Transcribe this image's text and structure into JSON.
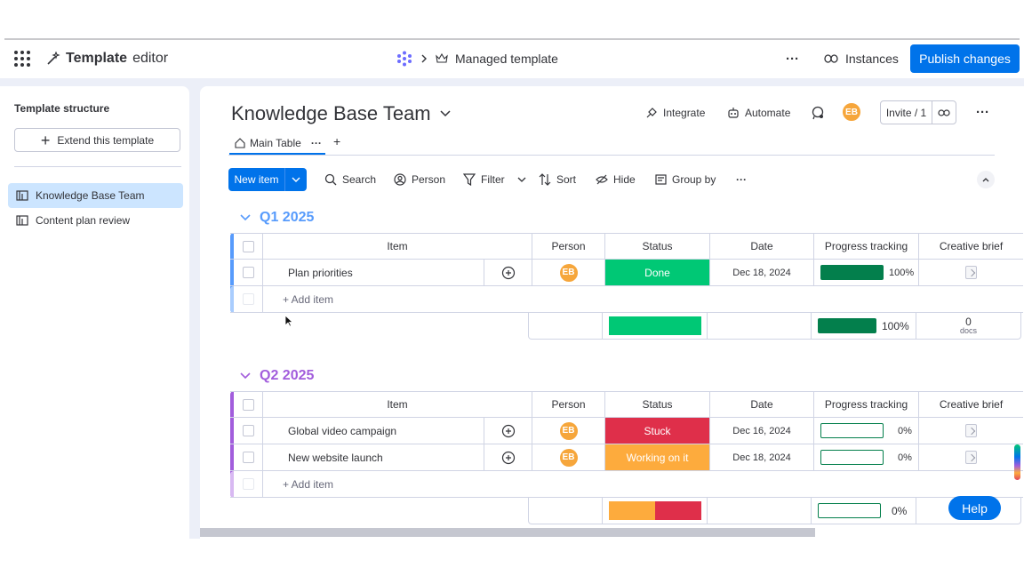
{
  "topbar": {
    "brand_bold": "Template",
    "brand_rest": "editor",
    "breadcrumb_current": "Managed template",
    "more_label": "···",
    "instances_label": "Instances",
    "publish_label": "Publish changes"
  },
  "sidebar": {
    "title": "Template structure",
    "extend_label": "Extend this template",
    "items": [
      {
        "label": "Knowledge Base Team",
        "active": true
      },
      {
        "label": "Content plan review",
        "active": false
      }
    ]
  },
  "board": {
    "title": "Knowledge Base Team",
    "integrate_label": "Integrate",
    "automate_label": "Automate",
    "avatar_initials": "EB",
    "invite_label": "Invite / 1",
    "tab_main": "Main Table",
    "toolbar": {
      "new_item": "New item",
      "search": "Search",
      "person": "Person",
      "filter": "Filter",
      "sort": "Sort",
      "hide": "Hide",
      "group_by": "Group by"
    },
    "columns": [
      "Item",
      "Person",
      "Status",
      "Date",
      "Progress tracking",
      "Creative brief"
    ],
    "add_item_label": "+ Add item",
    "groups": [
      {
        "title": "Q1 2025",
        "color": "#579bfc",
        "rows": [
          {
            "item": "Plan priorities",
            "person": "EB",
            "status": "Done",
            "status_color": "#00c875",
            "date": "Dec 18, 2024",
            "progress_pct": "100%",
            "progress": 1.0
          }
        ],
        "summary": {
          "progress_pct": "100%",
          "docs_count": "0",
          "docs_label": "docs"
        }
      },
      {
        "title": "Q2 2025",
        "color": "#a25ddc",
        "rows": [
          {
            "item": "Global video campaign",
            "person": "EB",
            "status": "Stuck",
            "status_color": "#df2f4a",
            "date": "Dec 16, 2024",
            "progress_pct": "0%",
            "progress": 0
          },
          {
            "item": "New website launch",
            "person": "EB",
            "status": "Working on it",
            "status_color": "#fdab3d",
            "date": "Dec 18, 2024",
            "progress_pct": "0%",
            "progress": 0
          }
        ],
        "summary": {
          "progress_pct": "0%"
        }
      }
    ]
  },
  "help_label": "Help"
}
